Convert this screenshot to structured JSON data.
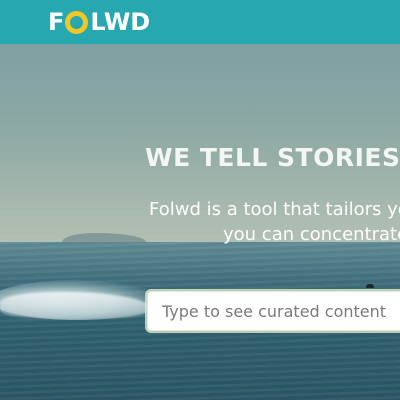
{
  "header": {
    "logo": {
      "letters_before": "F",
      "letters_after": "LWD",
      "ring_color": "#f3c623",
      "bar_color": "#27a8b1"
    }
  },
  "hero": {
    "title": "WE TELL STORIES S",
    "subtitle_line1": "Folwd is a tool that tailors yo",
    "subtitle_line2": "you can concentrate"
  },
  "search": {
    "placeholder": "Type to see curated content",
    "value": ""
  }
}
